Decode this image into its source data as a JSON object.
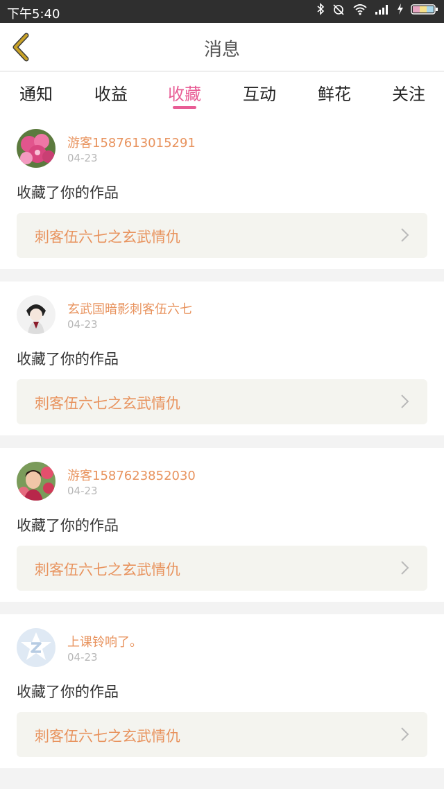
{
  "status": {
    "time": "下午5:40",
    "icons": [
      "bluetooth-icon",
      "alarm-off-icon",
      "wifi-icon",
      "signal-icon",
      "charging-icon",
      "battery-icon"
    ]
  },
  "header": {
    "title": "消息"
  },
  "tabs": [
    {
      "label": "通知"
    },
    {
      "label": "收益"
    },
    {
      "label": "收藏",
      "active": true
    },
    {
      "label": "互动"
    },
    {
      "label": "鲜花"
    },
    {
      "label": "关注"
    }
  ],
  "items": [
    {
      "username": "游客1587613015291",
      "date": "04-23",
      "action": "收藏了你的作品",
      "work": "刺客伍六七之玄武情仇"
    },
    {
      "username": "玄武国暗影刺客伍六七",
      "date": "04-23",
      "action": "收藏了你的作品",
      "work": "刺客伍六七之玄武情仇"
    },
    {
      "username": "游客1587623852030",
      "date": "04-23",
      "action": "收藏了你的作品",
      "work": "刺客伍六七之玄武情仇"
    },
    {
      "username": "上课铃响了。",
      "date": "04-23",
      "action": "收藏了你的作品",
      "work": "刺客伍六七之玄武情仇"
    }
  ],
  "colors": {
    "accent": "#e85d95",
    "username": "#e8935e",
    "back": "#c9a227"
  }
}
